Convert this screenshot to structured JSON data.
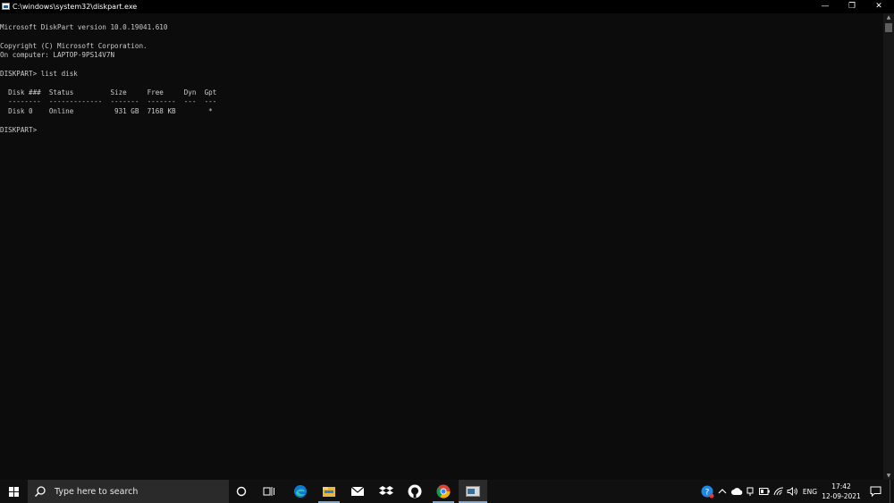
{
  "window": {
    "title": "C:\\windows\\system32\\diskpart.exe",
    "minimize_glyph": "—",
    "restore_glyph": "❐",
    "close_glyph": "✕"
  },
  "console": {
    "lines": [
      "Microsoft DiskPart version 10.0.19041.610",
      "",
      "Copyright (C) Microsoft Corporation.",
      "On computer: LAPTOP-9PS14V7N",
      "",
      "DISKPART> list disk",
      "",
      "  Disk ###  Status         Size     Free     Dyn  Gpt",
      "  --------  -------------  -------  -------  ---  ---",
      "  Disk 0    Online          931 GB  7168 KB        *",
      "",
      "DISKPART> "
    ]
  },
  "taskbar": {
    "search_placeholder": "Type here to search",
    "apps": [
      "cortana-icon",
      "task-view-icon",
      "edge-icon",
      "file-explorer-icon",
      "mail-icon",
      "dropbox-icon",
      "github-icon",
      "chrome-icon",
      "diskpart-console-icon"
    ],
    "tray": {
      "language": "ENG",
      "time": "17:42",
      "date": "12-09-2021"
    }
  },
  "colors": {
    "console_bg": "#0c0c0c",
    "console_fg": "#cccccc",
    "taskbar_bg": "#101010",
    "accent": "#7aa7d6"
  }
}
